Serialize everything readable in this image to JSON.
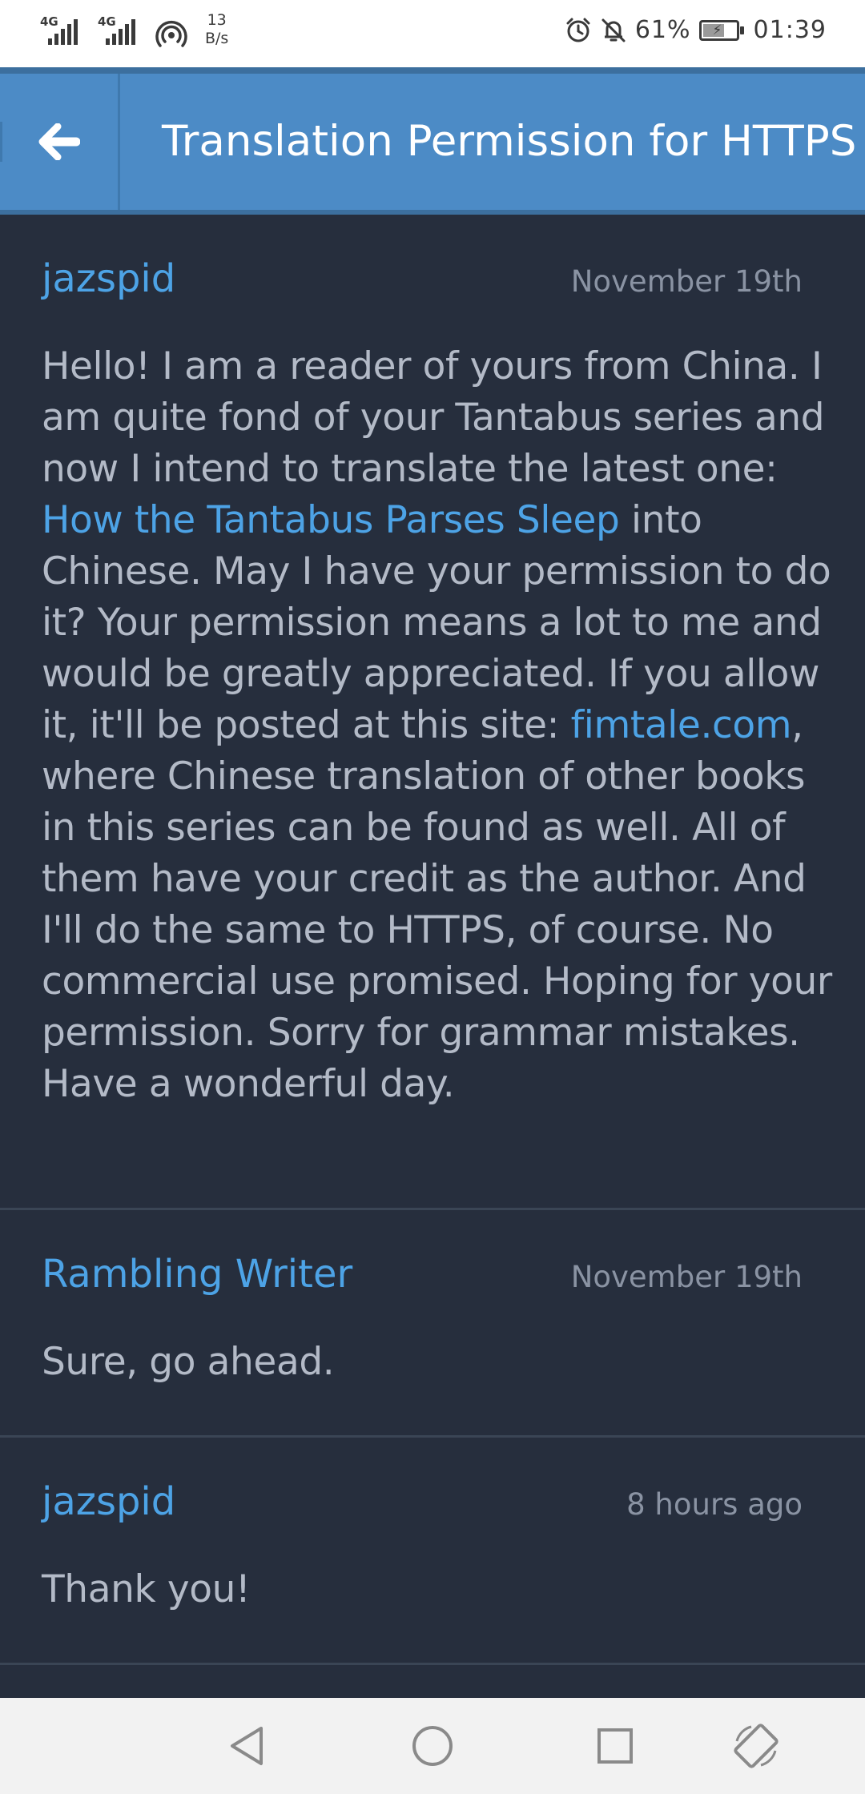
{
  "status_bar": {
    "network_1": "4G",
    "network_2": "4G",
    "speed_value": "13",
    "speed_unit": "B/s",
    "battery_percent": "61%",
    "battery_level": 0.61,
    "time": "01:39",
    "icons": [
      "signal-icon",
      "signal-icon",
      "hotspot-icon",
      "alarm-icon",
      "mute-bell-icon",
      "battery-charging-icon"
    ]
  },
  "header": {
    "title": "Translation Permission for HTTPS",
    "back_icon": "back-arrow-icon"
  },
  "comments": [
    {
      "author": "jazspid",
      "date": "November 19th",
      "body_part1": "Hello! I am a reader of yours from China. I am quite fond of your Tantabus series and now I intend to translate the latest one: ",
      "link1": "How the Tantabus Parses Sleep",
      "body_part2": " into Chinese. May I have your permission to do it? Your permission means a lot to me and would be greatly appreciated. If you allow it, it'll be posted at this site: ",
      "link2": "fimtale.com",
      "body_part3": ", where Chinese translation of other books in this series can be found as well. All of them have your credit as the author. And I'll do the same to HTTPS, of course. No commercial use promised. Hoping for your permission. Sorry for grammar mistakes. Have a wonderful day."
    },
    {
      "author": "Rambling Writer",
      "date": "November 19th",
      "body": "Sure, go ahead."
    },
    {
      "author": "jazspid",
      "date": "8 hours ago",
      "body": "Thank you!"
    }
  ],
  "nav_bar": {
    "buttons": [
      "back-triangle-icon",
      "home-circle-icon",
      "recents-square-icon",
      "rotate-icon"
    ]
  },
  "colors": {
    "header_bg": "#4c8bc6",
    "page_bg": "#262e3d",
    "link": "#4da3e6",
    "body_text": "#b3bac7",
    "date_text": "#8a93a3"
  }
}
